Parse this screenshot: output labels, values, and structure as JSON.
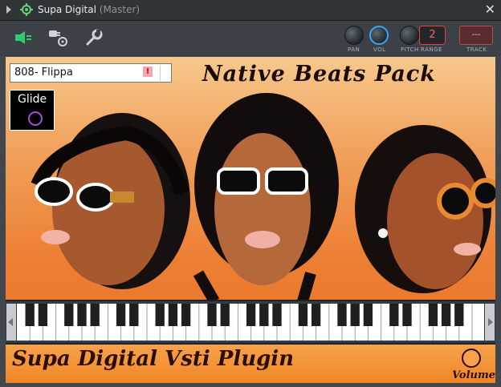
{
  "window": {
    "title": "Supa Digital",
    "title_suffix": "(Master)",
    "close_symbol": "✕"
  },
  "toolbar": {
    "knobs": [
      {
        "label": "PAN"
      },
      {
        "label": "VOL"
      },
      {
        "label": "PITCH"
      }
    ],
    "range_label": "RANGE",
    "range_value": "2",
    "track_label": "TRACK",
    "track_value": "---"
  },
  "plugin": {
    "preset_name": "808- Flippa",
    "preset_warning": "!",
    "glide_label": "Glide",
    "art_title": "Native Beats Pack",
    "footer_title": "Supa Digital Vsti Plugin",
    "volume_label": "Volume"
  },
  "colors": {
    "accent_blue": "#36a7ff",
    "orange": "#f18524",
    "active_green": "#2ecc71"
  }
}
